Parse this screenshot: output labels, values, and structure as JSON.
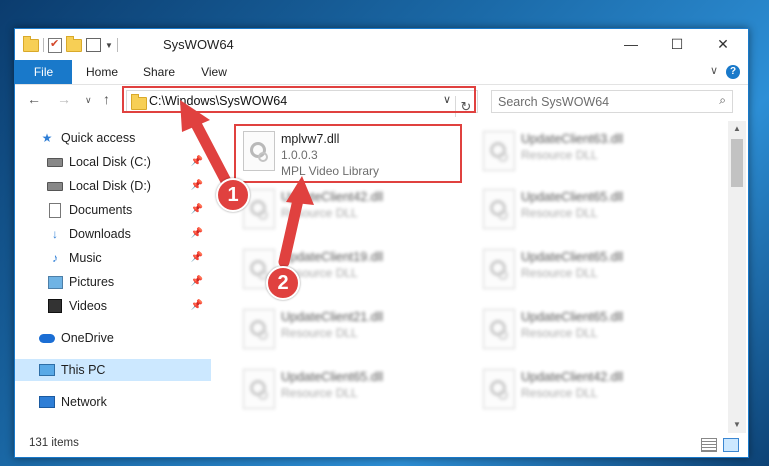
{
  "window": {
    "title": "SysWOW64",
    "minimize": "—",
    "maximize": "☐",
    "close": "✕"
  },
  "ribbon": {
    "tabs": [
      "File",
      "Home",
      "Share",
      "View"
    ],
    "expand": "∨",
    "help": "?"
  },
  "nav": {
    "back": "←",
    "forward": "→",
    "recent": "∨",
    "up": "↑",
    "address": "C:\\Windows\\SysWOW64",
    "address_dropdown": "∨",
    "refresh": "↻",
    "search_placeholder": "Search SysWOW64",
    "search_icon": "⌕"
  },
  "sidebar": {
    "items": [
      {
        "label": "Quick access",
        "icon": "star-icon"
      },
      {
        "label": "Local Disk (C:)",
        "icon": "disk-icon",
        "pinned": true
      },
      {
        "label": "Local Disk (D:)",
        "icon": "disk-icon",
        "pinned": true
      },
      {
        "label": "Documents",
        "icon": "document-icon",
        "pinned": true
      },
      {
        "label": "Downloads",
        "icon": "download-icon",
        "pinned": true
      },
      {
        "label": "Music",
        "icon": "music-icon",
        "pinned": true
      },
      {
        "label": "Pictures",
        "icon": "pictures-icon",
        "pinned": true
      },
      {
        "label": "Videos",
        "icon": "videos-icon",
        "pinned": true
      },
      {
        "label": "OneDrive",
        "icon": "onedrive-icon"
      },
      {
        "label": "This PC",
        "icon": "pc-icon",
        "selected": true
      },
      {
        "label": "Network",
        "icon": "network-icon"
      }
    ],
    "pin_glyph": "📌"
  },
  "files": {
    "highlighted": {
      "name": "mplvw7.dll",
      "version": "1.0.0.3",
      "description": "MPL Video Library"
    },
    "column1": [
      {
        "name": "UpdateClient42.dll",
        "sub": "Resource DLL"
      },
      {
        "name": "UpdateClient19.dll",
        "sub": "Resource DLL"
      },
      {
        "name": "UpdateClient21.dll",
        "sub": "Resource DLL"
      },
      {
        "name": "UpdateClient65.dll",
        "sub": "Resource DLL"
      }
    ],
    "column2": [
      {
        "name": "UpdateClient63.dll",
        "sub": "Resource DLL"
      },
      {
        "name": "UpdateClient65.dll",
        "sub": "Resource DLL"
      },
      {
        "name": "UpdateClient65.dll",
        "sub": "Resource DLL"
      },
      {
        "name": "UpdateClient65.dll",
        "sub": "Resource DLL"
      },
      {
        "name": "UpdateClient42.dll",
        "sub": "Resource DLL"
      }
    ]
  },
  "scrollbar": {
    "up": "▲",
    "down": "▼"
  },
  "status": {
    "item_count": "131 items"
  },
  "annotations": {
    "step1": "1",
    "step2": "2",
    "color": "#e0413f"
  }
}
